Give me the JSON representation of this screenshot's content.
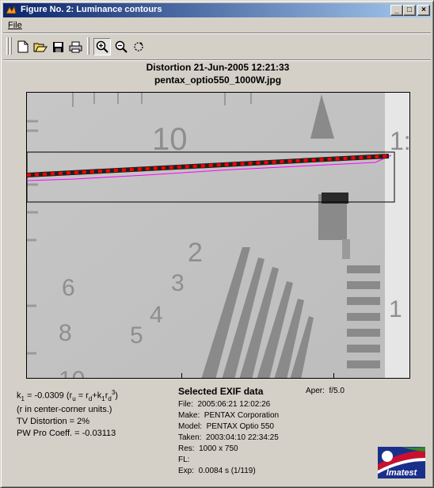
{
  "window": {
    "title": "Figure No. 2: Luminance contours",
    "controls": {
      "minimize": "_",
      "maximize": "□",
      "close": "×"
    }
  },
  "menu": {
    "file_label": "File"
  },
  "toolbar": {
    "tools": [
      "new-file-icon",
      "open-folder-icon",
      "save-icon",
      "print-icon",
      "zoom-in-icon",
      "zoom-out-icon",
      "rotate-icon"
    ],
    "active_tool": "zoom-in-icon"
  },
  "figure": {
    "title_line1": "Distortion   21-Jun-2005 12:21:33",
    "title_line2": "pentax_optio550_1000W.jpg",
    "chart_numbers": [
      "10",
      "1:",
      "2",
      "3",
      "4",
      "5",
      "6",
      "8",
      "10",
      "1"
    ]
  },
  "chart_data": {
    "type": "line",
    "title": "",
    "xlabel": "",
    "ylabel": "",
    "series": [
      {
        "values": [],
        "color": "#ff0000",
        "style": "dashed"
      },
      {
        "values": [],
        "color": "#ff00ff",
        "style": "solid"
      }
    ]
  },
  "stats": {
    "k1_prefix": "k",
    "k1_sub": "1",
    "k1_value": " = -0.0309 (r",
    "k1_rest_u": "u",
    "k1_rest_eq": " = r",
    "k1_rest_d": "d",
    "k1_rest_plus": "+k",
    "k1_rest_1": "1",
    "k1_rest_r": "r",
    "k1_rest_d2": "d",
    "k1_rest_3": "3",
    "k1_rest_close": ")",
    "units_note": "(r in center-corner units.)",
    "tv_distortion": "TV Distortion = 2%",
    "pw_pro": "PW Pro Coeff. = -0.03113"
  },
  "exif": {
    "heading": "Selected EXIF data",
    "aperture_label": "Aper:",
    "aperture_value": "f/5.0",
    "rows": [
      {
        "label": "File:",
        "value": "2005:06:21 12:02:26"
      },
      {
        "label": "Make:",
        "value": "PENTAX Corporation"
      },
      {
        "label": "Model:",
        "value": "PENTAX Optio 550"
      },
      {
        "label": "Taken:",
        "value": "2003:04:10 22:34:25"
      },
      {
        "label": "Res:",
        "value": "1000 x 750"
      },
      {
        "label": "FL:",
        "value": ""
      },
      {
        "label": "Exp:",
        "value": "0.0084 s   (1/119)"
      }
    ]
  },
  "logo": {
    "text": "Imatest"
  }
}
